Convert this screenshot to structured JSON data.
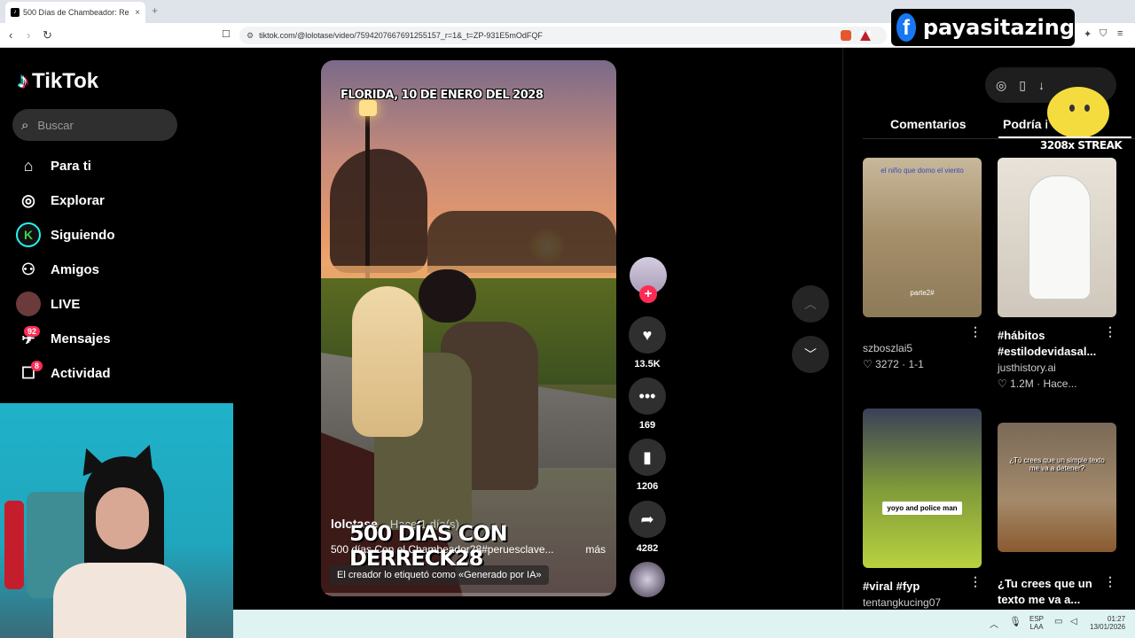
{
  "browser": {
    "tab_title": "500 Días de Chambeador: Re",
    "tab_close": "×",
    "new_tab": "+",
    "url": "tiktok.com/@lolotase/video/7594207667691255157_r=1&_t=ZP-931E5mOdFQF"
  },
  "overlay": {
    "fb_logo": "f",
    "fb_name": "payasitazing",
    "streak": "3208x STREAK"
  },
  "sidebar": {
    "logo": "TikTok",
    "search_placeholder": "Buscar",
    "items": [
      {
        "label": "Para ti",
        "icon": "home-icon"
      },
      {
        "label": "Explorar",
        "icon": "compass-icon"
      },
      {
        "label": "Siguiendo",
        "icon": "following-icon"
      },
      {
        "label": "Amigos",
        "icon": "friends-icon"
      },
      {
        "label": "LIVE",
        "icon": "live-icon"
      },
      {
        "label": "Mensajes",
        "icon": "messages-icon",
        "badge": "92"
      },
      {
        "label": "Actividad",
        "icon": "activity-icon",
        "badge": "8"
      }
    ]
  },
  "video": {
    "date_caption": "FLORIDA, 10 DE ENERO DEL 2028",
    "author": "lolotase",
    "time_ago": "· Hace 1 día(s)",
    "overlay_title": "500 DÍAS CON DERRECK28",
    "description": "500 días Con el Chambeador28#peruesclave...",
    "more": "más",
    "ai_label": "El creador lo etiquetó como «Generado por IA»",
    "progress": 0.02
  },
  "actions": {
    "likes": "13.5K",
    "comments": "169",
    "saves": "1206",
    "shares": "4282",
    "follow_plus": "+"
  },
  "right_panel": {
    "tabs": [
      "Comentarios",
      "Podría interesarte"
    ],
    "cards": [
      {
        "thumb_text": "el niño que domo el viento",
        "thumb_text2": "parte2#",
        "title": "",
        "author": "szboszlai5",
        "likes": "3272",
        "meta": "1-1"
      },
      {
        "thumb_text": "",
        "title": "#hábitos #estilodevidasal...",
        "author": "justhistory.ai",
        "likes": "1.2M",
        "meta": "Hace..."
      },
      {
        "thumb_text": "yoyo and police man",
        "title": "#viral #fyp",
        "author": "tentangkucing07",
        "likes": "",
        "meta": ""
      },
      {
        "thumb_text": "¿Tú crees que un simple texto me va a detener?",
        "title": "¿Tu crees que un texto me va a...",
        "author": "",
        "likes": "",
        "meta": ""
      }
    ]
  },
  "taskbar": {
    "lang": "ESP",
    "lang2": "LAA",
    "time": "01:27",
    "date": "13/01/2026"
  },
  "colors": {
    "accent": "#fe2c55",
    "fb_blue": "#1877f2"
  }
}
